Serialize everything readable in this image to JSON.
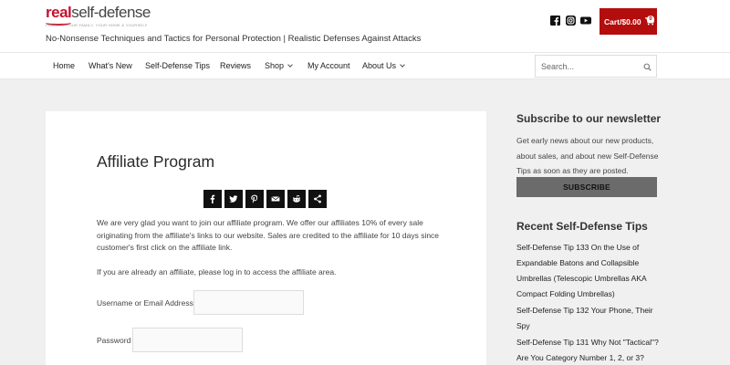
{
  "site": {
    "logo_red": "real",
    "logo_gray": "self-defense",
    "logo_sub": "PROTECT YOUR FAMILY, YOUR HOME & YOURSELF",
    "tagline": "No-Nonsense Techniques and Tactics for Personal Protection | Realistic Defenses Against Attacks"
  },
  "header": {
    "social_icons": [
      "facebook-icon",
      "instagram-icon",
      "youtube-icon"
    ],
    "cart_label": "Cart/$0.00",
    "cart_count": "0",
    "cart_color": "#b30d0d"
  },
  "nav": {
    "items": [
      {
        "label": "Home"
      },
      {
        "label": "What's New"
      },
      {
        "label": "Self-Defense Tips"
      },
      {
        "label": "Reviews"
      },
      {
        "label": "Shop"
      },
      {
        "label": "My Account"
      },
      {
        "label": "About Us"
      }
    ],
    "search_placeholder": "Search..."
  },
  "main": {
    "title": "Affiliate Program",
    "share_icons": [
      "facebook-icon",
      "twitter-icon",
      "pinterest-icon",
      "email-icon",
      "reddit-icon",
      "share-icon"
    ],
    "paragraph1": "We are very glad you want to join our affiliate program. We offer our affiliates 10% of every sale originating from the affiliate's links to our website. Sales are credited to the affiliate for 10 days since customer's first click on the affiliate link.",
    "paragraph2": "If you are already an affiliate, please log in to access the affiliate area.",
    "username_label": "Username or Email Address",
    "password_label": "Password"
  },
  "sidebar": {
    "newsletter_title": "Subscribe to our newsletter",
    "newsletter_text": "Get early news about our new products, about sales, and about new Self-Defense Tips as soon as they are posted.",
    "subscribe_label": "SUBSCRIBE",
    "recent_title": "Recent Self-Defense Tips",
    "recent_items": [
      "Self-Defense Tip 133 On the Use of Expandable Batons and Collapsible Umbrellas (Telescopic Umbrellas AKA Compact Folding Umbrellas)",
      "Self-Defense Tip 132 Your Phone, Their Spy",
      "Self-Defense Tip 131 Why Not \"Tactical\"? Are You Category Number 1, 2, or 3?"
    ]
  }
}
